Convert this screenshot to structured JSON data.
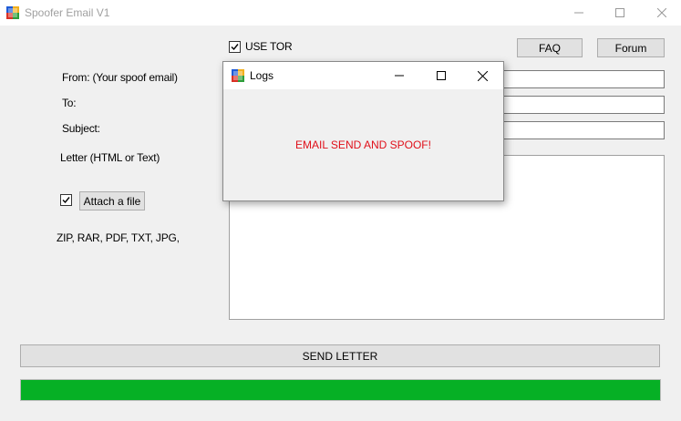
{
  "window": {
    "title": "Spoofer Email V1"
  },
  "form": {
    "use_tor_label": "USE TOR",
    "use_tor_checked": true,
    "from_label": "From: (Your spoof email)",
    "to_label": "To:",
    "subject_label": "Subject:",
    "letter_label": "Letter (HTML or Text)",
    "attach_checked": true,
    "attach_button": "Attach a file",
    "file_types": "ZIP, RAR, PDF, TXT, JPG,",
    "from_value": "",
    "to_value": "",
    "subject_value": "",
    "letter_value": ""
  },
  "toolbar": {
    "faq_label": "FAQ",
    "forum_label": "Forum"
  },
  "actions": {
    "send_label": "SEND LETTER"
  },
  "progress": {
    "percent": 100,
    "color": "#06b025"
  },
  "logs_dialog": {
    "title": "Logs",
    "message": "EMAIL SEND AND SPOOF!",
    "message_color": "#e0101a"
  }
}
